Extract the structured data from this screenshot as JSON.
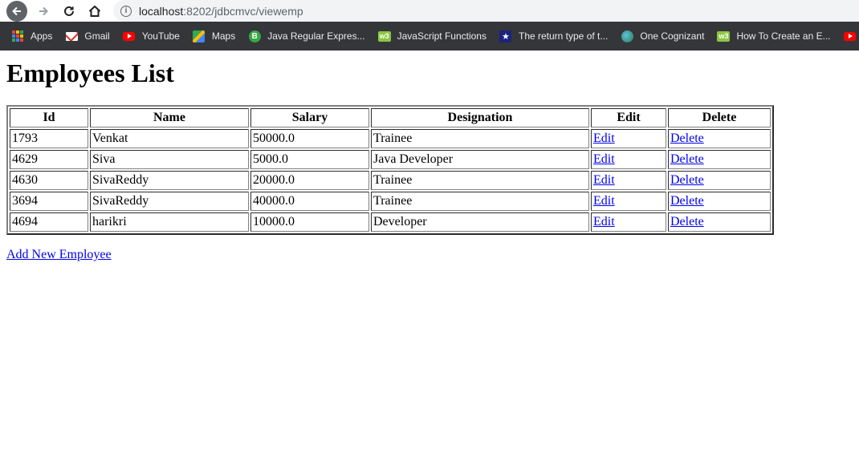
{
  "browser": {
    "url_host": "localhost",
    "url_path": ":8202/jdbcmvc/viewemp",
    "bookmarks": [
      {
        "label": "Apps",
        "icon": "apps-icon"
      },
      {
        "label": "Gmail",
        "icon": "gmail-icon"
      },
      {
        "label": "YouTube",
        "icon": "youtube-icon"
      },
      {
        "label": "Maps",
        "icon": "maps-icon"
      },
      {
        "label": "Java Regular Expres...",
        "icon": "bookmark-b-icon"
      },
      {
        "label": "JavaScript Functions",
        "icon": "w3schools-icon"
      },
      {
        "label": "The return type of t...",
        "icon": "star-icon"
      },
      {
        "label": "One Cognizant",
        "icon": "globe-icon"
      },
      {
        "label": "How To Create an E...",
        "icon": "w3schools-icon"
      },
      {
        "label": "#",
        "icon": "youtube-icon"
      }
    ]
  },
  "page": {
    "title": "Employees List",
    "table": {
      "headers": [
        "Id",
        "Name",
        "Salary",
        "Designation",
        "Edit",
        "Delete"
      ],
      "rows": [
        {
          "id": "1793",
          "name": "Venkat",
          "salary": "50000.0",
          "designation": "Trainee",
          "edit": "Edit",
          "delete": "Delete"
        },
        {
          "id": "4629",
          "name": "Siva",
          "salary": "5000.0",
          "designation": "Java Developer",
          "edit": "Edit",
          "delete": "Delete"
        },
        {
          "id": "4630",
          "name": "SivaReddy",
          "salary": "20000.0",
          "designation": "Trainee",
          "edit": "Edit",
          "delete": "Delete"
        },
        {
          "id": "3694",
          "name": "SivaReddy",
          "salary": "40000.0",
          "designation": "Trainee",
          "edit": "Edit",
          "delete": "Delete"
        },
        {
          "id": "4694",
          "name": "harikri",
          "salary": "10000.0",
          "designation": "Developer",
          "edit": "Edit",
          "delete": "Delete"
        }
      ]
    },
    "add_link": "Add New Employee"
  },
  "colors": {
    "link": "#0000ee",
    "bookmarks_bar": "#35363a",
    "omnibox": "#f1f3f4"
  }
}
